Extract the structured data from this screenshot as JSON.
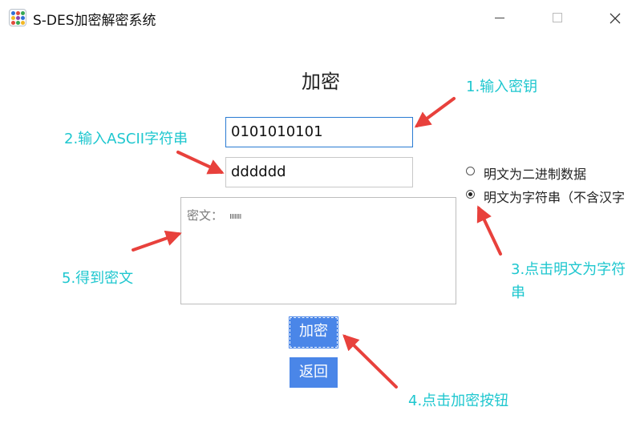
{
  "window": {
    "title": "S-DES加密解密系统",
    "icon": "app-grid-icon",
    "controls": [
      "minimize-icon",
      "maximize-icon",
      "close-icon"
    ]
  },
  "page": {
    "heading": "加密"
  },
  "form": {
    "key_value": "0101010101",
    "plaintext_value": "dddddd",
    "cipher_label": "密文：",
    "cipher_value": "ııııııı"
  },
  "options": {
    "binary_label": "明文为二进制数据",
    "string_label": "明文为字符串（不含汉字",
    "selected": "string"
  },
  "buttons": {
    "encrypt_label": "加密",
    "back_label": "返回"
  },
  "annotations": {
    "step1": "1.输入密钥",
    "step2": "2.输入ASCII字符串",
    "step3": "3.点击明文为字符串",
    "step4": "4.点击加密按钮",
    "step5": "5.得到密文"
  },
  "colors": {
    "accent": "#4a86e8",
    "annotation_text": "#1fc7cf",
    "arrow": "#e8413c",
    "focus_border": "#2a7bd3"
  }
}
